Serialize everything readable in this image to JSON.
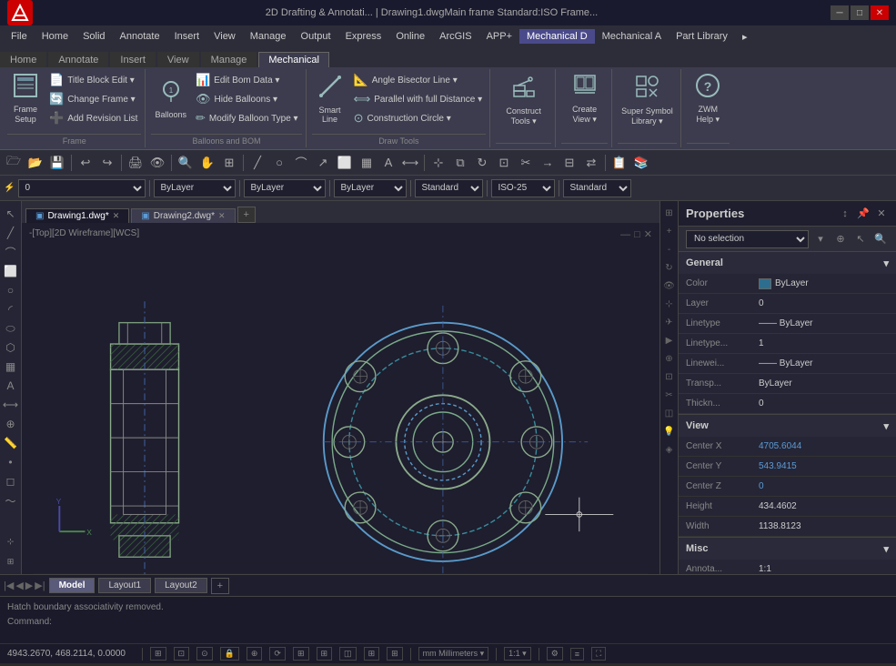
{
  "titlebar": {
    "app_name": "AutoCAD",
    "app_icon": "A",
    "title": "2D Drafting & Annotati...    |    Drawing1.dwgMain frame  Standard:ISO Frame...",
    "minimize": "─",
    "maximize": "□",
    "close": "✕"
  },
  "menubar": {
    "items": [
      "File",
      "Home",
      "Solid",
      "Annotate",
      "Insert",
      "View",
      "Manage",
      "Output",
      "Express",
      "Online",
      "ArcGIS",
      "APP+",
      "Mechanical D",
      "Mechanical A",
      "Part Library"
    ]
  },
  "ribbon": {
    "active_tab": "Mechanical D",
    "groups": [
      {
        "label": "Frame",
        "buttons": [
          {
            "icon": "🖼",
            "label": "Frame\nSetup",
            "type": "large"
          },
          {
            "items": [
              "Title Block Edit ▾",
              "Change Frame ▾",
              "Add Revision List"
            ]
          }
        ]
      },
      {
        "label": "Balloons and BOM",
        "buttons": [
          {
            "icon": "🔵",
            "label": "Balloons",
            "type": "large"
          },
          {
            "items": [
              "Edit Bom Data ▾",
              "Hide Balloons ▾",
              "Modify Balloon Type ▾"
            ]
          }
        ]
      },
      {
        "label": "Draw Tools",
        "buttons": [
          {
            "icon": "📐",
            "label": "Smart\nLine",
            "type": "large"
          },
          {
            "items": [
              "Angle Bisector Line ▾",
              "Parallel with full Distance ▾",
              "Construction Circle ▾"
            ]
          }
        ]
      },
      {
        "label": "",
        "buttons": [
          {
            "icon": "🔧",
            "label": "Construct\nTools ▾",
            "type": "large"
          }
        ]
      },
      {
        "label": "",
        "buttons": [
          {
            "icon": "👁",
            "label": "Create\nView ▾",
            "type": "large"
          }
        ]
      },
      {
        "label": "",
        "buttons": [
          {
            "icon": "⭐",
            "label": "Super Symbol\nLibrary ▾",
            "type": "large"
          }
        ]
      },
      {
        "label": "",
        "buttons": [
          {
            "icon": "❓",
            "label": "ZWM\nHelp ▾",
            "type": "large"
          }
        ]
      }
    ]
  },
  "toolbar1": {
    "buttons": [
      "🗁",
      "💾",
      "✂",
      "📋",
      "↩",
      "↪",
      "⚙",
      "🔍",
      "📏",
      "✏",
      "⬜",
      "○",
      "↗",
      "—",
      "📌"
    ]
  },
  "toolbar2": {
    "layer_value": "0",
    "layer_options": [
      "0"
    ],
    "linetype": "ByLayer",
    "lineweight": "ByLayer",
    "color_value": "ByLayer",
    "color_options": [
      "ByLayer"
    ],
    "standard_value": "Standard",
    "iso_value": "ISO-25",
    "standard2_value": "Standard"
  },
  "drawing_tabs": [
    {
      "label": "Drawing1.dwg",
      "active": true,
      "modified": true
    },
    {
      "label": "Drawing2.dwg",
      "active": false,
      "modified": true
    }
  ],
  "canvas": {
    "view_label": "-[Top][2D Wireframe][WCS]"
  },
  "properties": {
    "title": "Properties",
    "selection": "No selection",
    "sections": [
      {
        "name": "General",
        "expanded": true,
        "rows": [
          {
            "label": "Color",
            "value": "ByLayer",
            "has_swatch": true
          },
          {
            "label": "Layer",
            "value": "0"
          },
          {
            "label": "Linetype",
            "value": "— ByLayer"
          },
          {
            "label": "Linetype...",
            "value": "1"
          },
          {
            "label": "Linewei...",
            "value": "—— ByLayer"
          },
          {
            "label": "Transp...",
            "value": "ByLayer"
          },
          {
            "label": "Thickn...",
            "value": "0"
          }
        ]
      },
      {
        "name": "View",
        "expanded": true,
        "rows": [
          {
            "label": "Center X",
            "value": "4705.6044",
            "accent": true
          },
          {
            "label": "Center Y",
            "value": "543.9415",
            "accent": true
          },
          {
            "label": "Center Z",
            "value": "0",
            "accent": true
          },
          {
            "label": "Height",
            "value": "434.4602"
          },
          {
            "label": "Width",
            "value": "1138.8123"
          }
        ]
      },
      {
        "name": "Misc",
        "expanded": true,
        "rows": [
          {
            "label": "Annota...",
            "value": "1:1"
          }
        ]
      }
    ]
  },
  "bottom_tabs": {
    "tabs": [
      "Model",
      "Layout1",
      "Layout2"
    ]
  },
  "command_bar": {
    "line1": "Hatch boundary associativity removed.",
    "line2": "Command:"
  },
  "status_bar": {
    "coords": "4943.2670, 468.2114, 0.0000",
    "buttons": [
      "⊞",
      "⊡",
      "⊙",
      "🔒",
      "⊕",
      "⟳",
      "⊞",
      "⊞",
      "◫",
      "⊞",
      "⊞",
      "mm Millimeters ▾",
      "1:1 ▾",
      "⚙",
      "≡"
    ]
  }
}
